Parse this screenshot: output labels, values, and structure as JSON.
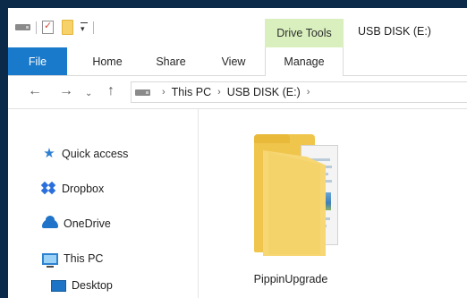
{
  "window": {
    "title": "USB DISK (E:)"
  },
  "ribbon": {
    "context_header": "Drive Tools",
    "tabs": [
      {
        "label": "File"
      },
      {
        "label": "Home"
      },
      {
        "label": "Share"
      },
      {
        "label": "View"
      },
      {
        "label": "Manage"
      }
    ]
  },
  "address": {
    "crumbs": [
      "This PC",
      "USB DISK (E:)"
    ]
  },
  "nav_pane": {
    "items": [
      {
        "label": "Quick access",
        "icon": "star-icon"
      },
      {
        "label": "Dropbox",
        "icon": "dropbox-icon"
      },
      {
        "label": "OneDrive",
        "icon": "cloud-icon"
      },
      {
        "label": "This PC",
        "icon": "computer-icon"
      },
      {
        "label": "Desktop",
        "icon": "desktop-icon"
      }
    ]
  },
  "content": {
    "items": [
      {
        "name": "PippinUpgrade",
        "icon": "folder-icon"
      }
    ]
  },
  "colors": {
    "file_tab": "#1979ca",
    "context_tab": "#d9f0be",
    "folder": "#f7d774"
  }
}
